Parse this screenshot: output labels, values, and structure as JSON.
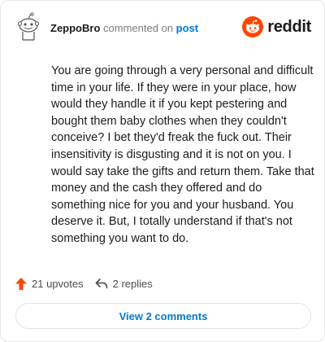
{
  "header": {
    "username": "ZeppoBro",
    "action_text": "commented on",
    "post_link": "post",
    "brand": "reddit",
    "avatar_icon": "reddit-avatar-icon",
    "logo_icon": "reddit-snoo-icon"
  },
  "comment": {
    "body": "You are going through a very personal and difficult time in your life. If they were in your place, how would they handle it if you kept pestering and bought them baby clothes when they couldn't conceive? I bet they'd freak the fuck out. Their insensitivity is disgusting and it is not on you. I would say take the gifts and return them. Take that money and the cash they offered and do something nice for you and your husband. You deserve it. But, I totally understand if that's not something you want to do."
  },
  "footer": {
    "upvotes": "21 upvotes",
    "replies": "2 replies",
    "upvote_icon": "upvote-arrow-icon",
    "reply_icon": "reply-arrow-icon"
  },
  "view_button": {
    "label": "View 2 comments"
  },
  "colors": {
    "brand_orange": "#ff4500",
    "link_blue": "#0079d3",
    "muted_text": "#7c7c7c"
  }
}
